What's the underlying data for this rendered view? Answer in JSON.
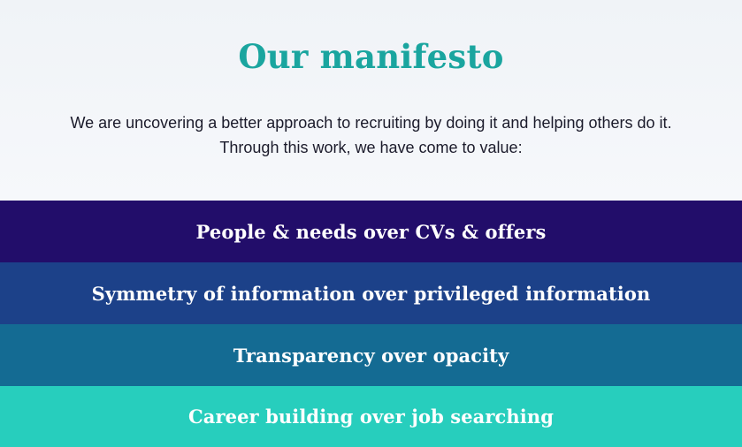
{
  "manifesto": {
    "title": "Our manifesto",
    "intro_line_1": "We are uncovering a better approach to recruiting by doing it and helping others do it.",
    "intro_line_2": "Through this work, we have come to value:",
    "values": [
      "People & needs over CVs & offers",
      "Symmetry of information over privileged information",
      "Transparency over opacity",
      "Career building over job searching"
    ]
  },
  "colors": {
    "title": "#1aa59f",
    "band_1": "#220d6a",
    "band_2": "#1c4189",
    "band_3": "#146b93",
    "band_4": "#27cebd"
  }
}
